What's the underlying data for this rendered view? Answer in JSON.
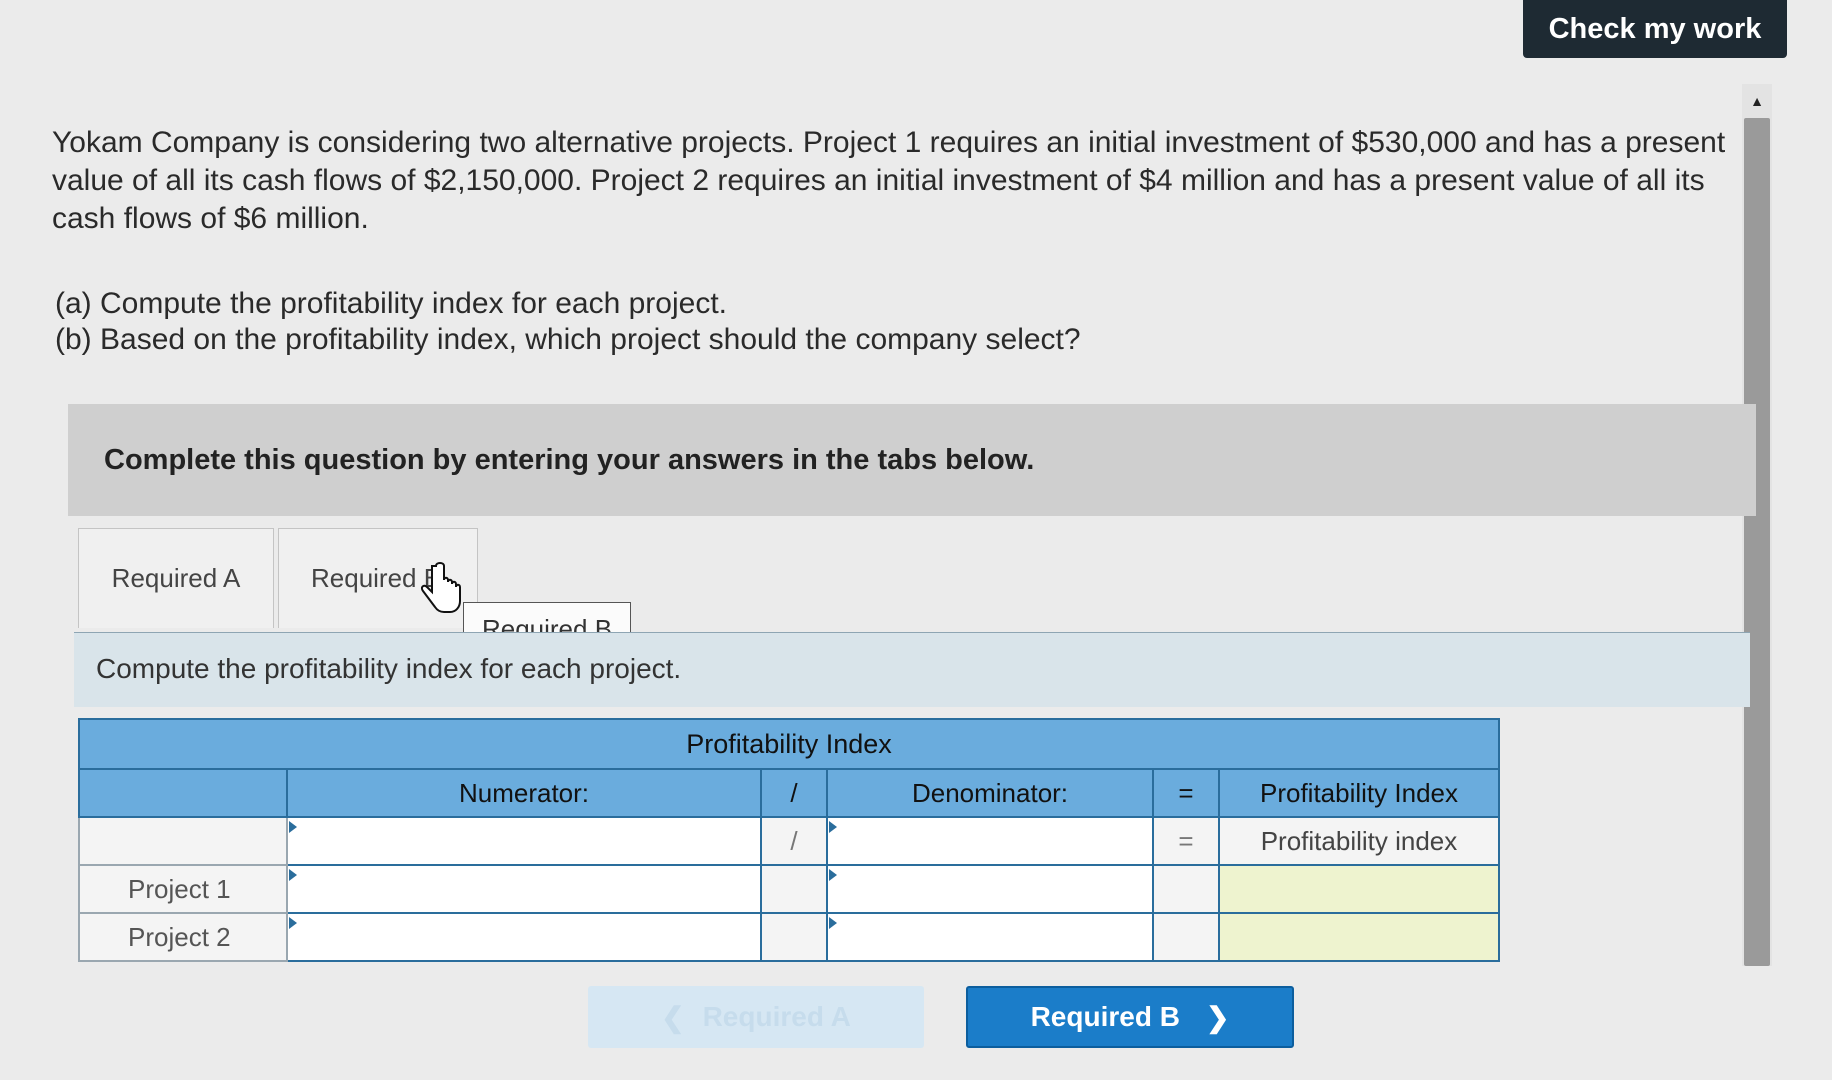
{
  "header": {
    "check_label": "Check my work"
  },
  "question": {
    "prompt": "Yokam Company is considering two alternative projects. Project 1 requires an initial investment of $530,000 and has a present value of all its cash flows of $2,150,000. Project 2 requires an initial investment of $4 million and has a present value of all its cash flows of $6 million.",
    "part_a": "(a) Compute the profitability index for each project.",
    "part_b": "(b) Based on the profitability index, which project should the company select?"
  },
  "instructions": "Complete this question by entering your answers in the tabs below.",
  "tabs": [
    {
      "label": "Required A"
    },
    {
      "label": "Required B"
    }
  ],
  "tooltip": "Required B",
  "tab_description": "Compute the profitability index for each project.",
  "table": {
    "title": "Profitability Index",
    "col_numerator": "Numerator:",
    "col_divide": "/",
    "col_denominator": "Denominator:",
    "col_equals": "=",
    "col_result": "Profitability Index",
    "row0_divide": "/",
    "row0_equals": "=",
    "row0_result": "Profitability index",
    "rows": [
      {
        "label": "Project 1"
      },
      {
        "label": "Project 2"
      }
    ]
  },
  "nav": {
    "prev_label": "Required A",
    "next_label": "Required B",
    "next_chevron": "❯",
    "prev_chevron": "❮"
  },
  "colors": {
    "accent": "#1b7dc9",
    "header_blue": "#6aacdd",
    "dark_button": "#1e2a33",
    "result_fill": "#eef3cf"
  }
}
